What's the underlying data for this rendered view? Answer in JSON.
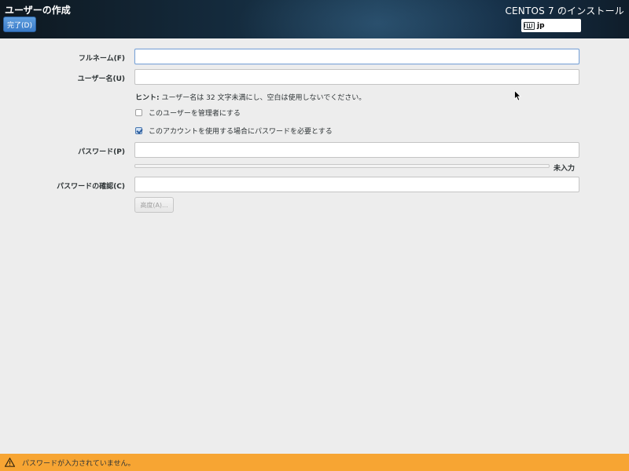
{
  "header": {
    "spoke_title": "ユーザーの作成",
    "done_label": "完了(D)",
    "product_title": "CENTOS 7 のインストール",
    "keyboard_layout": "jp",
    "keyboard_icon": "keyboard-icon"
  },
  "form": {
    "fullname_label": "フルネーム(F)",
    "fullname_value": "",
    "username_label": "ユーザー名(U)",
    "username_value": "",
    "hint_prefix": "ヒント:",
    "hint_text": " ユーザー名は 32 文字未満にし、空白は使用しないでください。",
    "admin_check_label": "このユーザーを管理者にする",
    "admin_checked": false,
    "require_password_label": "このアカウントを使用する場合にパスワードを必要とする",
    "require_password_checked": true,
    "password_label": "パスワード(P)",
    "password_value": "",
    "strength_label": "未入力",
    "confirm_label": "パスワードの確認(C)",
    "confirm_value": "",
    "advanced_label": "高度(A)..."
  },
  "status": {
    "warning_text": "パスワードが入力されていません。",
    "warning_color": "#f7a533",
    "warning_icon": "warning-icon"
  }
}
